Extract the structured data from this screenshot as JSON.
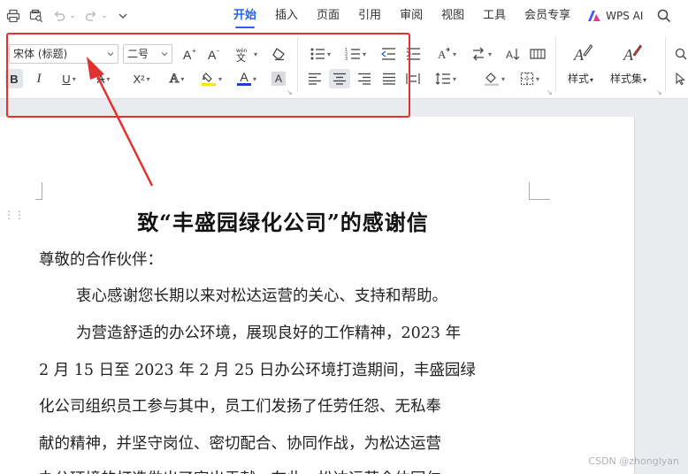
{
  "menu": {
    "items": [
      "开始",
      "插入",
      "页面",
      "引用",
      "审阅",
      "视图",
      "工具",
      "会员专享"
    ],
    "active": "开始",
    "wps_ai": "WPS AI",
    "accent": "#2463eb"
  },
  "ribbon": {
    "font_name": "宋体 (标题)",
    "font_size": "二号",
    "style_label": "样式",
    "style_set_label": "样式集",
    "bold": "B",
    "italic": "I",
    "underline": "U",
    "strike": "A",
    "superscript": "X²",
    "text_effect": "A",
    "font_color": "A",
    "char_shade": "A",
    "highlight_color": "#f5e11c",
    "font_color_value": "#1b3fd6",
    "alignment": "center"
  },
  "document": {
    "title": "致“丰盛园绿化公司”的感谢信",
    "salutation": "尊敬的合作伙伴：",
    "lines": [
      "衷心感谢您长期以来对松达运营的关心、支持和帮助。",
      "为营造舒适的办公环境，展现良好的工作精神，2023 年",
      "2 月 15 日至 2023 年 2 月 25 日办公环境打造期间，丰盛园绿",
      "化公司组织员工参与其中，员工们发扬了任劳任怨、无私奉",
      "献的精神，并坚守岗位、密切配合、协同作战，为松达运营",
      "办公环境的打造做出了突出贡献。在此，松达运营全体同仁"
    ]
  },
  "annotation": {
    "color": "#e1322f"
  },
  "watermark": "CSDN @zhonglyan"
}
